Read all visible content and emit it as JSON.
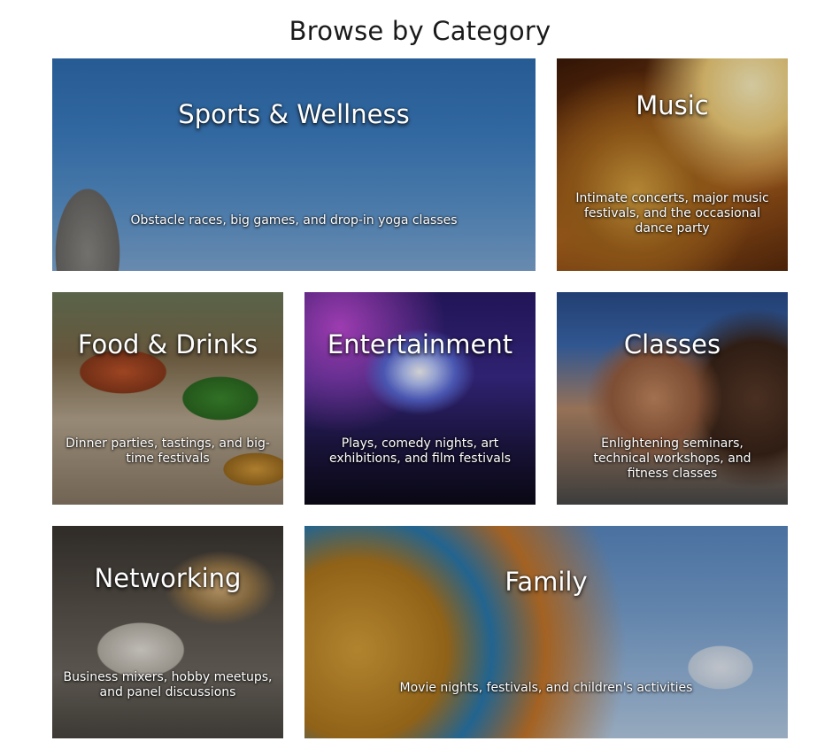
{
  "page": {
    "title": "Browse by Category"
  },
  "categories": [
    {
      "name": "Sports & Wellness",
      "description": "Obstacle races, big games, and drop-in yoga classes"
    },
    {
      "name": "Music",
      "description": "Intimate concerts, major music festivals, and the occasional dance party"
    },
    {
      "name": "Food & Drinks",
      "description": "Dinner parties, tastings, and big-time festivals"
    },
    {
      "name": "Entertainment",
      "description": "Plays, comedy nights, art exhibitions, and film festivals"
    },
    {
      "name": "Classes",
      "description": "Enlightening seminars, technical workshops, and fitness classes"
    },
    {
      "name": "Networking",
      "description": "Business mixers, hobby meetups, and panel discussions"
    },
    {
      "name": "Family",
      "description": "Movie nights, festivals, and children's activities"
    }
  ]
}
